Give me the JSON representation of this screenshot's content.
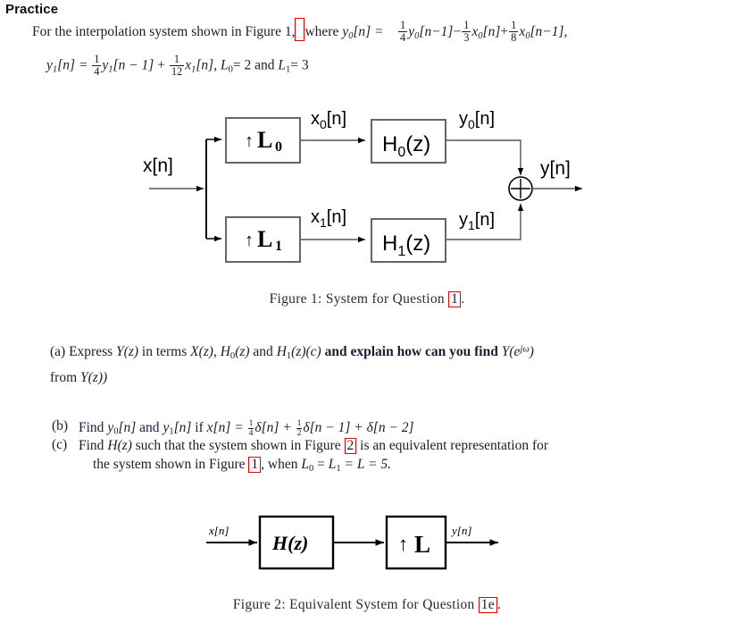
{
  "document": {
    "heading": "Practice",
    "intro": {
      "lead": "For the interpolation system shown in Figure 1,",
      "after_ref": "where",
      "y0_lhs": "y",
      "y0_sub": "0",
      "y0_bracket": "[n] =",
      "term1_num": "1",
      "term1_den": "4",
      "term1_body": "y",
      "term1_sub": "0",
      "term1_arg": "[n−1]",
      "minus": "−",
      "term2_num": "1",
      "term2_den": "3",
      "term2_body": "x",
      "term2_sub": "0",
      "term2_arg": "[n]",
      "plus": "+",
      "term3_num": "1",
      "term3_den": "8",
      "term3_body": "x",
      "term3_sub": "0",
      "term3_arg": "[n−1],",
      "line2_lhs": "y",
      "line2_lhs_sub": "1",
      "line2_lhs_rest": "[n] =",
      "line2_t1_num": "1",
      "line2_t1_den": "4",
      "line2_t1_body": "y",
      "line2_t1_sub": "1",
      "line2_t1_arg": "[n − 1]",
      "line2_plus": "+",
      "line2_t2_num": "1",
      "line2_t2_den": "12",
      "line2_t2_body": "x",
      "line2_t2_sub": "1",
      "line2_t2_arg": "[n],",
      "line2_tail_L0": "L",
      "line2_tail_L0_sub": "0",
      "line2_tail_eq2": "= 2 and",
      "line2_tail_L1": "L",
      "line2_tail_L1_sub": "1",
      "line2_tail_eq3": "= 3"
    },
    "questions": {
      "a": {
        "marker": "(a)",
        "line1_p1": "Express",
        "line1_Y": "Y",
        "line1_z1": "(z)",
        "line1_p2": "in terms",
        "line1_X": "X",
        "line1_z2": "(z),",
        "line1_H0": "H",
        "line1_H0_sub": "0",
        "line1_z3": "(z)",
        "line1_and": "and",
        "line1_H1": "H",
        "line1_H1_sub": "1",
        "line1_z4": "(z)(c)",
        "line1_p3": "and explain how can you find",
        "line1_Y2": "Y",
        "line1_ejw_open": "(e",
        "line1_ejw_sup": "jω",
        "line1_ejw_close": ")",
        "line2_p1": "from",
        "line2_Y": "Y",
        "line2_z": "(z))"
      },
      "b": {
        "marker": "(b)",
        "p1": "Find",
        "y0": "y",
        "y0_sub": "0",
        "y0_arg": "[n]",
        "and": "and",
        "y1": "y",
        "y1_sub": "1",
        "y1_arg": "[n]",
        "if_": "if",
        "x": "x",
        "x_arg": "[n] =",
        "f1_num": "1",
        "f1_den": "4",
        "d1": "δ[n] +",
        "f2_num": "1",
        "f2_den": "2",
        "d2": "δ[n − 1] + δ[n − 2]"
      },
      "c": {
        "marker": "(c)",
        "l1_p1": "Find",
        "l1_H": "H",
        "l1_z": "(z)",
        "l1_p2": "such that the system shown in Figure",
        "l1_ref": "2",
        "l1_p3": "is an equivalent representation for",
        "l2_p1": "the system shown in Figure",
        "l2_ref": "1",
        "l2_p2": ", when",
        "l2_L0": "L",
        "l2_L0_sub": "0",
        "l2_eq1": "=",
        "l2_L1": "L",
        "l2_L1_sub": "1",
        "l2_eq2": "= L = 5."
      }
    },
    "figure1": {
      "caption_prefix": "Figure 1: System for Question",
      "caption_ref": "1",
      "caption_suffix": ".",
      "input_label": "x[n]",
      "upsampler0_arrow": "↑",
      "upsampler0_label": "L",
      "upsampler0_sub": "0",
      "upsampler1_arrow": "↑",
      "upsampler1_label": "L",
      "upsampler1_sub": "1",
      "x0_label": "x",
      "x0_sub": "0",
      "x0_arg": "[n]",
      "x1_label": "x",
      "x1_sub": "1",
      "x1_arg": "[n]",
      "filter0_label": "H",
      "filter0_sub": "0",
      "filter0_arg": "(z)",
      "filter1_label": "H",
      "filter1_sub": "1",
      "filter1_arg": "(z)",
      "y0_label": "y",
      "y0_sub": "0",
      "y0_arg": "[n]",
      "y1_label": "y",
      "y1_sub": "1",
      "y1_arg": "[n]",
      "adder_symbol": "⊕",
      "output_label": "y[n]"
    },
    "figure2": {
      "caption_prefix": "Figure 2: Equivalent System for Question",
      "caption_ref": "1e",
      "caption_suffix": ".",
      "input_label": "x[n]",
      "filter_label": "H(z)",
      "upsampler_arrow": "↑",
      "upsampler_label": "L",
      "output_label": "y[n]"
    },
    "colors": {
      "text": "#1b1b33",
      "heading": "#101010",
      "ref_box_border": "#e00000",
      "diagram_stroke": "#000000",
      "figure1_box_stroke": "#555555",
      "background": "#ffffff"
    }
  }
}
